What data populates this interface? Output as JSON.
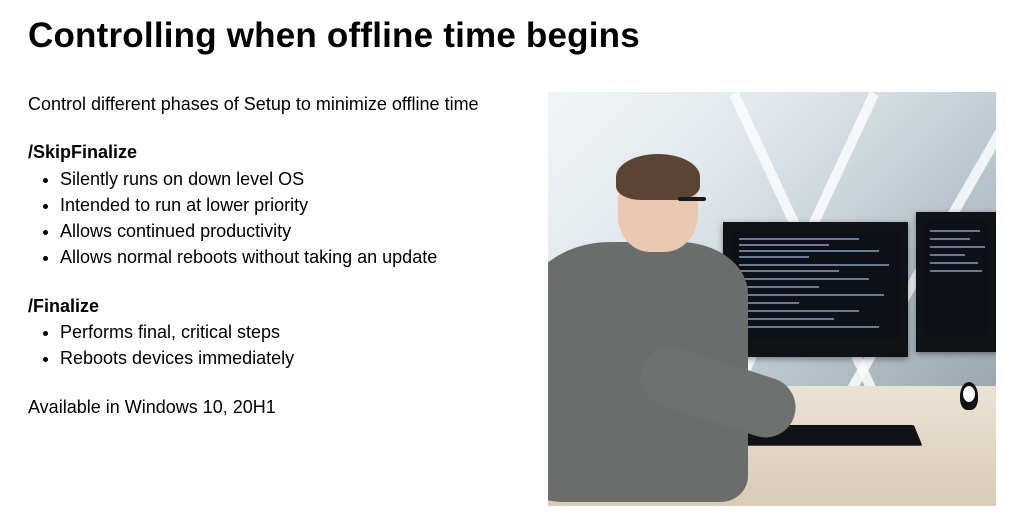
{
  "title": "Controlling when offline time begins",
  "intro": "Control different phases of Setup to minimize offline time",
  "sections": [
    {
      "heading": "/SkipFinalize",
      "bullets": [
        "Silently runs on down level OS",
        "Intended to run at lower priority",
        "Allows continued productivity",
        "Allows normal reboots without taking an update"
      ]
    },
    {
      "heading": "/Finalize",
      "bullets": [
        "Performs final, critical steps",
        "Reboots devices immediately"
      ]
    }
  ],
  "availability": "Available in Windows 10, 20H1",
  "image_alt": "Person in a grey sweater and glasses working at a desk with dual monitors showing code, in a modern office with angled glass-and-steel window structure"
}
